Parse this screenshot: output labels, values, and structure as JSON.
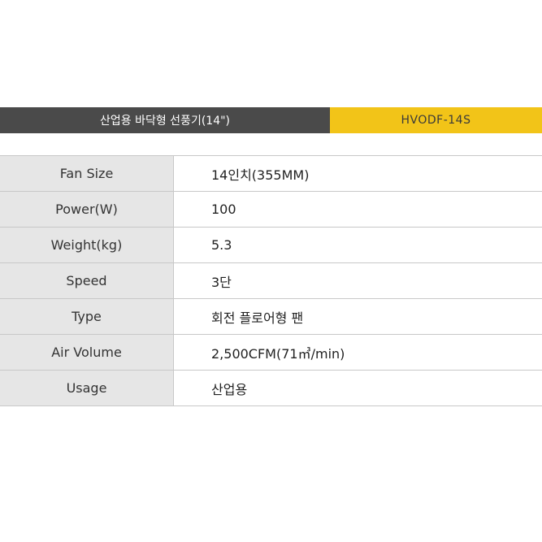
{
  "header": {
    "product_name": "산업용 바닥형 선풍기(14\")",
    "model_code": "HVODF-14S"
  },
  "specs": [
    {
      "label": "Fan Size",
      "value": "14인치(355MM)"
    },
    {
      "label": "Power(W)",
      "value": "100"
    },
    {
      "label": "Weight(kg)",
      "value": "5.3"
    },
    {
      "label": "Speed",
      "value": "3단"
    },
    {
      "label": "Type",
      "value": "회전 플로어형 팬"
    },
    {
      "label": "Air Volume",
      "value": "2,500CFM(71㎥/min)"
    },
    {
      "label": "Usage",
      "value": "산업용"
    }
  ],
  "colors": {
    "title_bg": "#4a4a4a",
    "accent": "#f2c418",
    "label_bg": "#e6e6e6"
  }
}
